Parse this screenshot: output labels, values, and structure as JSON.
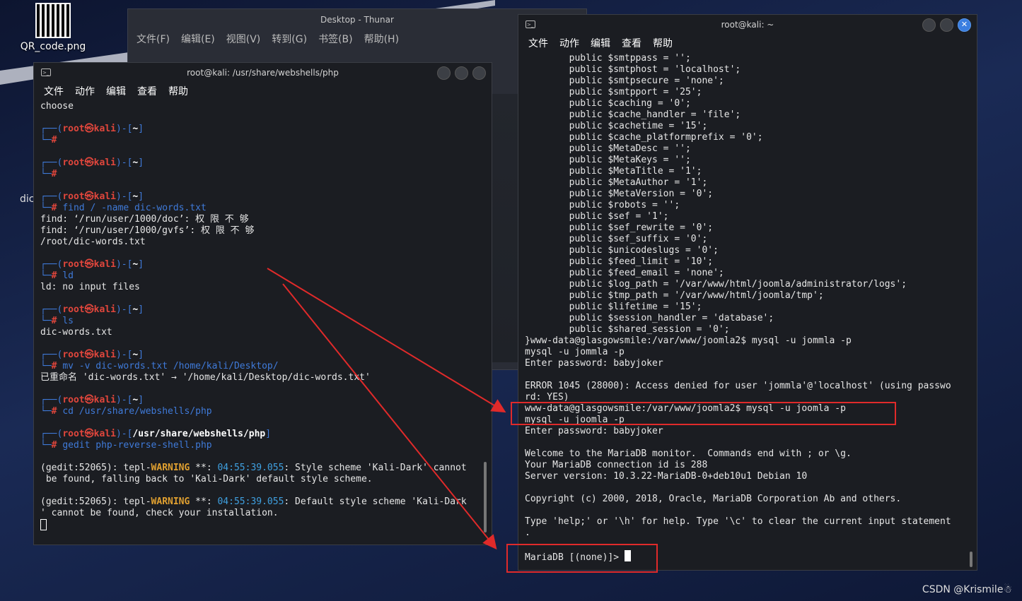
{
  "desktop": {
    "qr_label": "QR_code.png",
    "dic_label": "dic",
    "watermark": "CSDN @Krismile☃"
  },
  "thunar": {
    "title": "Desktop - Thunar",
    "menu": [
      "文件(F)",
      "编辑(E)",
      "视图(V)",
      "转到(G)",
      "书签(B)",
      "帮助(H)"
    ]
  },
  "left_terminal": {
    "title": "root@kali: /usr/share/webshells/php",
    "menu": [
      "文件",
      "动作",
      "编辑",
      "查看",
      "帮助"
    ],
    "first_line": "choose",
    "prompt_user": "root㉿kali",
    "home_dir": "~",
    "php_dir": "/usr/share/webshells/php",
    "cmd_find": "find / -name dic-words.txt",
    "out_find": [
      "find: ‘/run/user/1000/doc’: 权 限 不 够",
      "find: ‘/run/user/1000/gvfs’: 权 限 不 够",
      "/root/dic-words.txt"
    ],
    "cmd_ld": "ld",
    "out_ld": "ld: no input files",
    "cmd_ls": "ls",
    "out_ls": "dic-words.txt",
    "cmd_mv": "mv -v dic-words.txt /home/kali/Desktop/",
    "out_mv": "已重命名 'dic-words.txt' → '/home/kali/Desktop/dic-words.txt'",
    "cmd_cd": "cd /usr/share/webshells/php",
    "cmd_gedit": "gedit php-reverse-shell.php",
    "gedit_pid": "(gedit:52065): tepl-",
    "warning": "WARNING",
    "stars": " **: ",
    "ts1": "04:55:39.055",
    "warn1_a": ": Style scheme 'Kali-Dark' cannot",
    "warn1_b": " be found, falling back to 'Kali-Dark' default style scheme.",
    "ts2": "04:55:39.055",
    "warn2_a": ": Default style scheme 'Kali-Dark",
    "warn2_b": "' cannot be found, check your installation."
  },
  "right_terminal": {
    "title": "root@kali: ~",
    "menu": [
      "文件",
      "动作",
      "编辑",
      "查看",
      "帮助"
    ],
    "config_lines": [
      "        public $smtppass = '';",
      "        public $smtphost = 'localhost';",
      "        public $smtpsecure = 'none';",
      "        public $smtpport = '25';",
      "        public $caching = '0';",
      "        public $cache_handler = 'file';",
      "        public $cachetime = '15';",
      "        public $cache_platformprefix = '0';",
      "        public $MetaDesc = '';",
      "        public $MetaKeys = '';",
      "        public $MetaTitle = '1';",
      "        public $MetaAuthor = '1';",
      "        public $MetaVersion = '0';",
      "        public $robots = '';",
      "        public $sef = '1';",
      "        public $sef_rewrite = '0';",
      "        public $sef_suffix = '0';",
      "        public $unicodeslugs = '0';",
      "        public $feed_limit = '10';",
      "        public $feed_email = 'none';",
      "        public $log_path = '/var/www/html/joomla/administrator/logs';",
      "        public $tmp_path = '/var/www/html/joomla/tmp';",
      "        public $lifetime = '15';",
      "        public $session_handler = 'database';",
      "        public $shared_session = '0';"
    ],
    "mysql_lines": [
      "}www-data@glasgowsmile:/var/www/joomla2$ mysql -u jommla -p",
      "mysql -u jommla -p",
      "Enter password: babyjoker",
      "",
      "ERROR 1045 (28000): Access denied for user 'jommla'@'localhost' (using passwo",
      "rd: YES)",
      "www-data@glasgowsmile:/var/www/joomla2$ mysql -u joomla -p",
      "mysql -u joomla -p",
      "Enter password: babyjoker",
      "",
      "Welcome to the MariaDB monitor.  Commands end with ; or \\g.",
      "Your MariaDB connection id is 288",
      "Server version: 10.3.22-MariaDB-0+deb10u1 Debian 10",
      "",
      "Copyright (c) 2000, 2018, Oracle, MariaDB Corporation Ab and others.",
      "",
      "Type 'help;' or '\\h' for help. Type '\\c' to clear the current input statement",
      ".",
      ""
    ],
    "mariadb_prompt": "MariaDB [(none)]> "
  }
}
